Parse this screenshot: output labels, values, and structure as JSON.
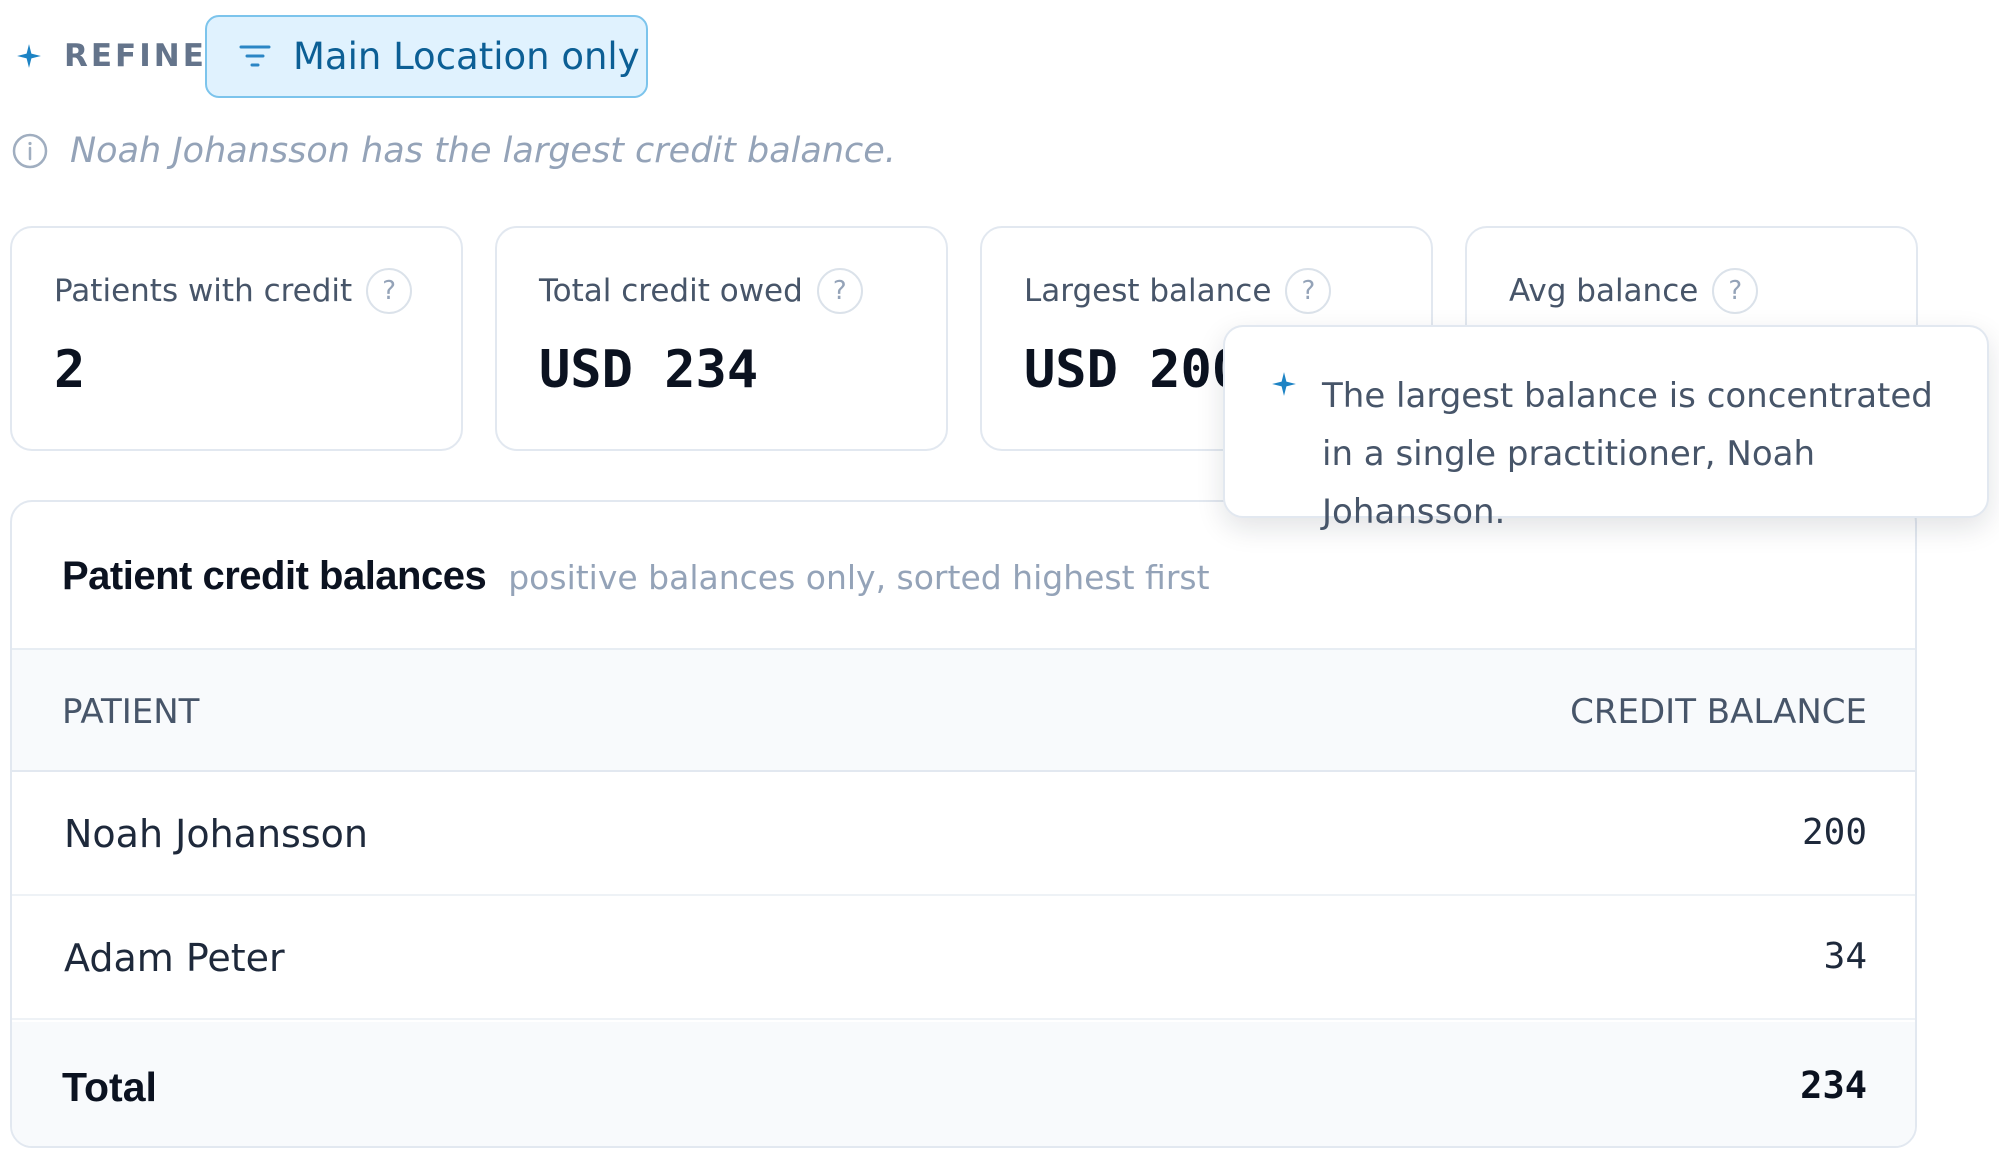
{
  "refine": {
    "label": "REFINE",
    "filter_chip_label": "Main Location only"
  },
  "insight": {
    "text": "Noah Johansson has the largest credit balance."
  },
  "stats": [
    {
      "label": "Patients with credit",
      "value": "2"
    },
    {
      "label": "Total credit owed",
      "value": "USD 234"
    },
    {
      "label": "Largest balance",
      "value": "USD 200"
    },
    {
      "label": "Avg balance",
      "value": ""
    }
  ],
  "help_glyph": "?",
  "tooltip": {
    "text": "The largest balance is concentrated in a single practitioner, Noah Johansson."
  },
  "table": {
    "title": "Patient credit balances",
    "subtitle": "positive balances only, sorted highest first",
    "columns": [
      "PATIENT",
      "CREDIT BALANCE"
    ],
    "rows": [
      {
        "patient": "Noah Johansson",
        "balance": "200"
      },
      {
        "patient": "Adam Peter",
        "balance": "34"
      }
    ],
    "total": {
      "label": "Total",
      "balance": "234"
    }
  },
  "colors": {
    "accent": "#0c5f95",
    "chip_background": "#e0f2fe",
    "sparkle": "#1d83c4",
    "muted_text": "#94a3b8"
  },
  "icons": {
    "refine": "sparkle-icon",
    "filter": "filter-icon",
    "insight": "info-icon",
    "help": "help-icon",
    "tooltip": "sparkle-icon"
  }
}
